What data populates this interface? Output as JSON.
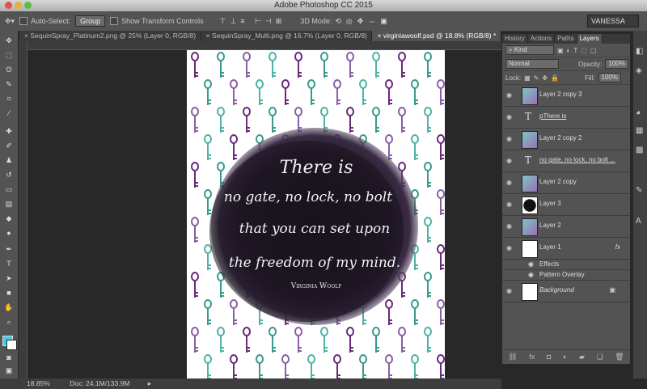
{
  "window": {
    "title": "Adobe Photoshop CC 2015"
  },
  "options": {
    "auto_select_label": "Auto-Select:",
    "auto_select_value": "Group",
    "transform_label": "Show Transform Controls",
    "mode_3d_label": "3D Mode:",
    "workspace": "VANESSA"
  },
  "tabs": [
    {
      "label": "SequinSpray_Platinum2.png @ 25% (Layer 0, RGB/8)"
    },
    {
      "label": "SequinSpray_Multi.png @ 16.7% (Layer 0, RGB/8)"
    },
    {
      "label": "virginiawoolf.psd @ 18.8% (RGB/8) *"
    }
  ],
  "artwork": {
    "quote_line1": "There is",
    "quote_line2": "no gate, no lock, no bolt",
    "quote_line3": "that you can set upon",
    "quote_line4": "the freedom of my mind.",
    "author": "Virginia Woolf"
  },
  "status": {
    "zoom": "18.85%",
    "doc": "Doc: 24.1M/133.9M"
  },
  "panel": {
    "tabs": [
      "History",
      "Actions",
      "Paths",
      "Layers"
    ],
    "kind_label": "Kind",
    "blend_mode": "Normal",
    "opacity_label": "Opacity:",
    "opacity_value": "100%",
    "lock_label": "Lock:",
    "fill_label": "Fill:",
    "fill_value": "100%",
    "layers": [
      {
        "name": "Layer 2 copy 3",
        "type": "pixel"
      },
      {
        "name": "pThere is",
        "type": "text"
      },
      {
        "name": "Layer 2 copy 2",
        "type": "pixel"
      },
      {
        "name": "no gate, no lock, no bolt ...",
        "type": "text"
      },
      {
        "name": "Layer 2 copy",
        "type": "pixel"
      },
      {
        "name": "Layer 3",
        "type": "pixel"
      },
      {
        "name": "Layer 2",
        "type": "pixel"
      },
      {
        "name": "Layer 1",
        "type": "pixel"
      }
    ],
    "effects_label": "Effects",
    "effect_item": "Pattern Overlay",
    "fx_badge": "fx",
    "background_layer": "Background"
  },
  "colors": {
    "accent_fg": "#3fd0e8",
    "ink_purple": "#6a2a7a",
    "ink_teal": "#3a9a8a"
  }
}
